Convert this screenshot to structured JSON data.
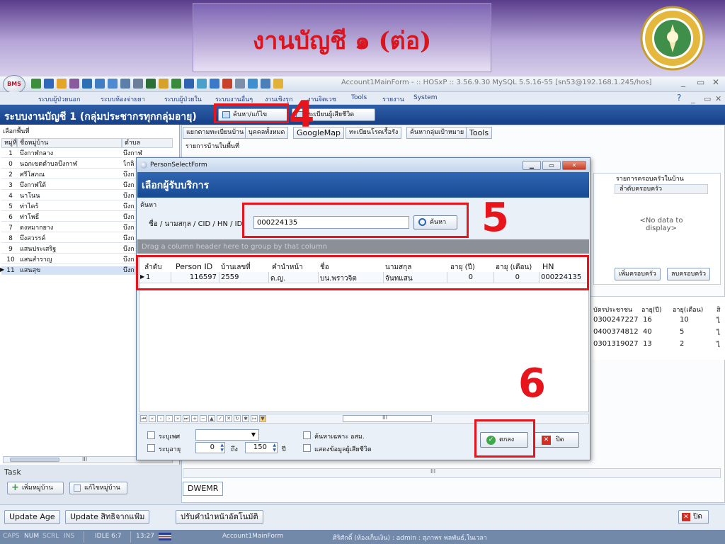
{
  "banner": {
    "title": "งานบัญชี ๑  (ต่อ)"
  },
  "app": {
    "orb_label": "BMS",
    "window_title": "Account1MainForm - :: HOSxP :: 3.56.9.30 MySQL 5.5.16-55 [sn53@192.168.1.245/hos]",
    "window_controls": [
      "_",
      "▭",
      "✕"
    ],
    "menu": [
      "ระบบผู้ป่วยนอก",
      "ระบบห้องจ่ายยา",
      "ระบบผู้ป่วยใน",
      "ระบบงานอื่นๆ",
      "งานเชิงรุก",
      "งานจิตเวช",
      "Tools",
      "รายงาน",
      "System"
    ],
    "menu_controls": [
      "?",
      "_",
      "▭",
      "✕"
    ]
  },
  "header": {
    "title": "ระบบงานบัญชี 1 (กลุ่มประชากรทุกกลุ่มอายุ)",
    "buttons": [
      "ค้นหา/แก้ไข",
      "ทะเบียนผู้เสียชีวิต"
    ]
  },
  "left": {
    "label": "เลือกพื้นที่",
    "columns": [
      "หมู่ที่",
      "ชื่อหมู่บ้าน",
      "ตำบล"
    ],
    "rows": [
      [
        "1",
        "บึงกาฬกลาง",
        "บึงกาฬ"
      ],
      [
        "0",
        "นอกเขตตำบลบึงกาฬ",
        "ไกลิ"
      ],
      [
        "2",
        "ศรีโสภณ",
        "บึงก"
      ],
      [
        "3",
        "บึงกาฬใต้",
        "บึงก"
      ],
      [
        "4",
        "นาโนน",
        "บึงก"
      ],
      [
        "5",
        "ท่าไคร้",
        "บึงก"
      ],
      [
        "6",
        "ท่าโพธิ์",
        "บึงก"
      ],
      [
        "7",
        "ดงหมากยาง",
        "บึงก"
      ],
      [
        "8",
        "บึงสวรรค์",
        "บึงก"
      ],
      [
        "9",
        "แสนประเสริฐ",
        "บึงก"
      ],
      [
        "10",
        "แสนสำราญ",
        "บึงก"
      ],
      [
        "11",
        "แสนสุข",
        "บึงก"
      ]
    ],
    "scroll_text": "III",
    "task_label": "Task",
    "task_buttons": [
      "เพิ่มหมู่บ้าน",
      "แก้ไขหมู่บ้าน"
    ]
  },
  "right": {
    "tabs": [
      "แยกตามทะเบียนบ้าน",
      "บุคคลทั้งหมด",
      "GoogleMap",
      "ทะเบียนโรคเรื้อรัง",
      "ค้นหากลุ่มเป้าหมาย",
      "Tools"
    ],
    "area_label": "รายการบ้านในพื้นที่",
    "family_group_title": "รายการครอบครัวในบ้าน",
    "family_column": "ลำดับครอบครัว",
    "no_data": "<No data to\ndisplay>",
    "family_buttons": [
      "เพิ่มครอบครัว",
      "ลบครอบครัว"
    ],
    "member_columns": [
      "บัตรประชาชน",
      "อายุ(ปี)",
      "อายุ(เดือน)",
      "สิ"
    ],
    "member_rows": [
      [
        "0300247227",
        "16",
        "10",
        "ไ"
      ],
      [
        "0400374812",
        "40",
        "5",
        "ไ"
      ],
      [
        "0301319027",
        "13",
        "2",
        "ไ"
      ]
    ],
    "dwemr_tab": "DWEMR"
  },
  "bottom": {
    "buttons": [
      "Update Age",
      "Update สิทธิจากแฟ้ม",
      "ปรับคำนำหน้าอัตโนมัติ"
    ],
    "close": "ปิด"
  },
  "status": {
    "caps": "CAPS",
    "num": "NUM",
    "scrl": "SCRL",
    "ins": "INS",
    "idle": "IDLE 6:7",
    "time": "13:27",
    "form": "Account1MainForm",
    "user": "ศิริศักดิ์ (ห้องเก็บเงิน) : admin : สุภาพร พลพันธ์,ในเวลา"
  },
  "dialog": {
    "window_title": "PersonSelectForm",
    "heading": "เลือกผู้รับบริการ",
    "search_group": "ค้นหา",
    "search_label": "ชื่อ / นามสกุล / CID / HN / ID",
    "search_value": "000224135",
    "search_button": "ค้นหา",
    "group_hint": "Drag a column header here to group by that column",
    "columns": [
      "ลำดับ",
      "Person ID",
      "บ้านเลขที่",
      "คำนำหน้า",
      "ชื่อ",
      "นามสกุล",
      "อายุ (ปี)",
      "อายุ (เดือน)",
      "HN"
    ],
    "rows": [
      [
        "1",
        "116597",
        "2559",
        "ด.ญ.",
        "บน.พราวจิต",
        "จันทแสน",
        "0",
        "0",
        "000224135"
      ]
    ],
    "filter_sex_label": "ระบุเพศ",
    "filter_age_label": "ระบุอายุ",
    "age_from": "0",
    "age_to_label": "ถึง",
    "age_to": "150",
    "age_unit": "ปี",
    "option_osm": "ค้นหาเฉพาะ อสม.",
    "option_deceased": "แสดงข้อมูลผู้เสียชีวิต",
    "ok_button": "ตกลง",
    "close_button": "ปิด",
    "scroll_text": "III"
  },
  "annotations": {
    "step4": "4",
    "step5": "5",
    "step6": "6",
    "color": "#e8141c"
  }
}
